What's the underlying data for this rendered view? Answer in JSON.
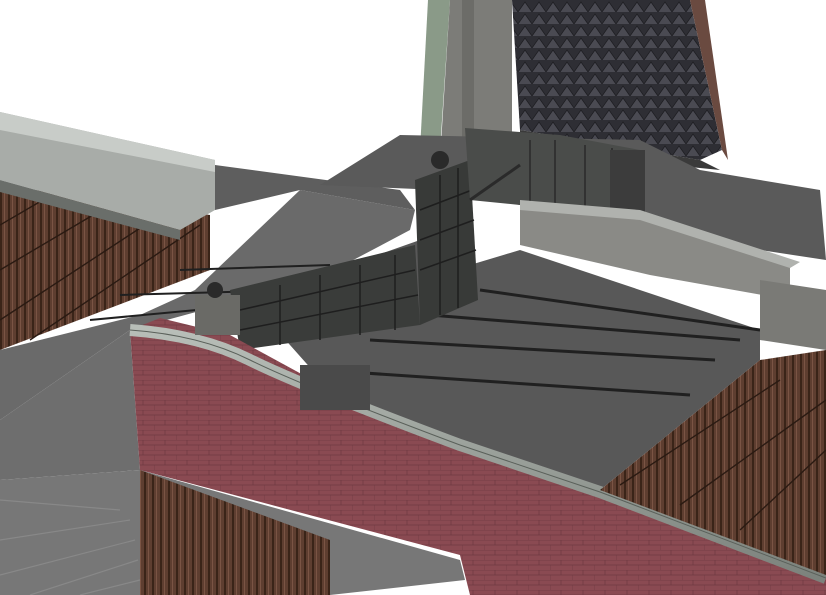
{
  "viewport": {
    "background": "#ffffff"
  },
  "scene": {
    "subject": "lock-gate-chamber-3d-render",
    "colors": {
      "concrete_top": "#646464",
      "concrete_dark": "#4a4a4a",
      "gate_steel": "#3a3a3a",
      "brick_wall": "#8a4a50",
      "timber_piling": "#5a3a2c",
      "roof_tiles": "#3c3c40",
      "capping": "#9aa09a"
    }
  }
}
